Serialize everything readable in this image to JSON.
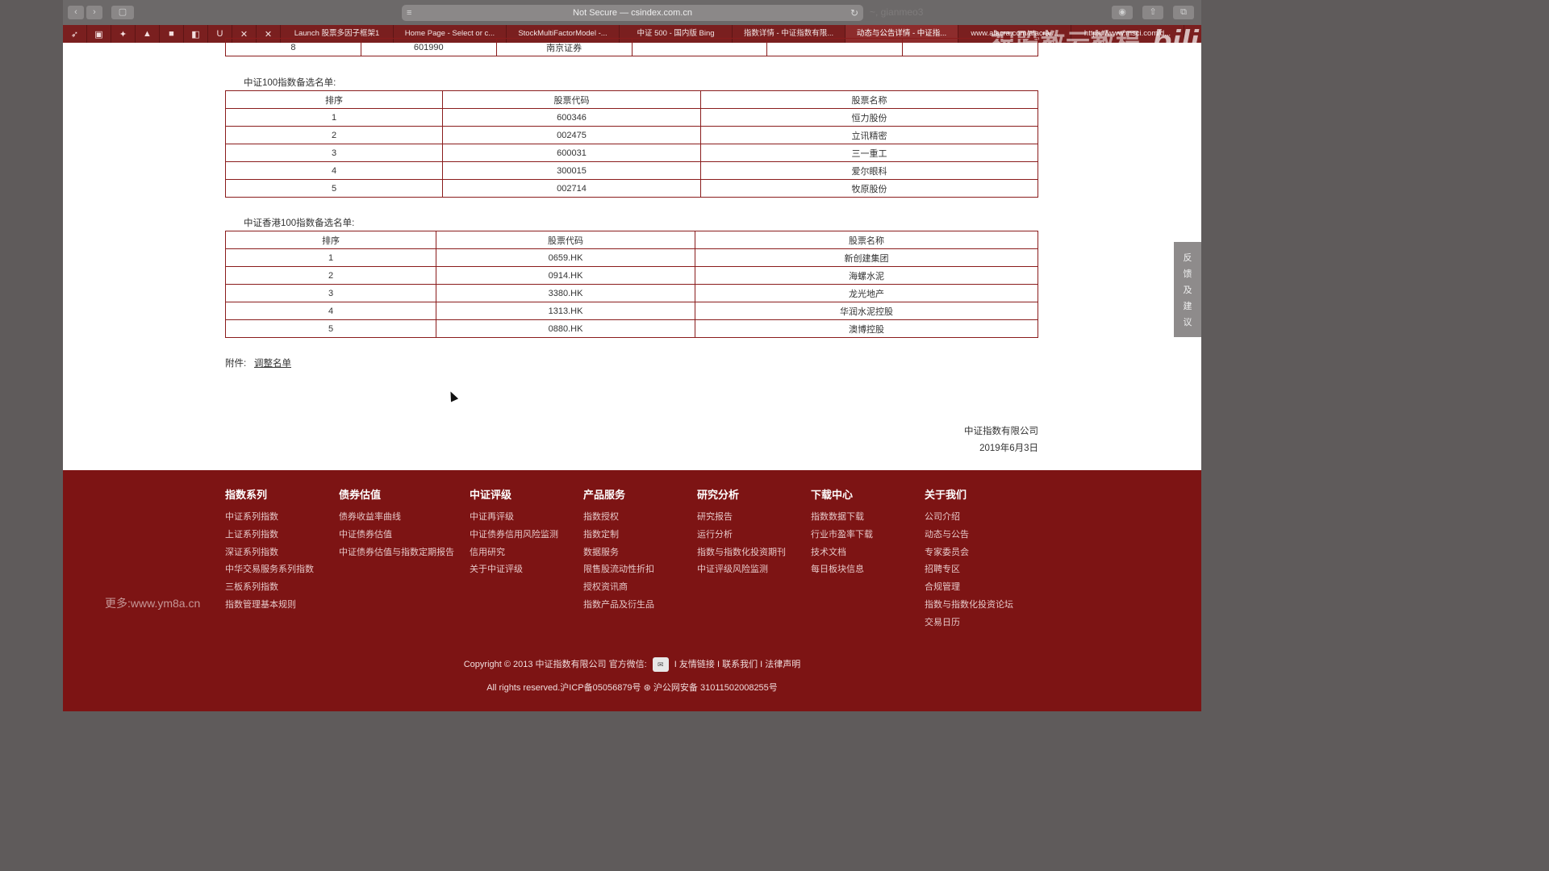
{
  "browser": {
    "back": "‹",
    "forward": "›",
    "sidebar_icon": "▢",
    "address": "Not Secure — csindex.com.cn",
    "user_ghost": "~, gianmeo3",
    "tabs": [
      "Launch 股票多因子框架1",
      "Home Page - Select or c...",
      "StockMultiFactorModel -...",
      "中证 500 - 国内版 Bing",
      "指数详情 - 中证指数有限...",
      "动态与公告详情 - 中证指...",
      "www.alacra.com/alacra/...",
      "https://www.msci.com/d..."
    ],
    "active_tab": 5,
    "favicons": [
      "bird-icon",
      "bilibili-icon",
      "vertex-icon",
      "a-icon",
      "box-icon",
      "bookmark-icon",
      "u-icon",
      "x-icon",
      "x2-icon"
    ]
  },
  "watermark": {
    "text": "祝股教云教程",
    "logo": "bilibili"
  },
  "top_row": {
    "rank": "8",
    "code": "601990",
    "name": "南京证券"
  },
  "csi100": {
    "caption": "中证100指数备选名单:",
    "headers": [
      "排序",
      "股票代码",
      "股票名称"
    ],
    "rows": [
      [
        "1",
        "600346",
        "恒力股份"
      ],
      [
        "2",
        "002475",
        "立讯精密"
      ],
      [
        "3",
        "600031",
        "三一重工"
      ],
      [
        "4",
        "300015",
        "爱尔眼科"
      ],
      [
        "5",
        "002714",
        "牧原股份"
      ]
    ]
  },
  "csihk100": {
    "caption": "中证香港100指数备选名单:",
    "headers": [
      "排序",
      "股票代码",
      "股票名称"
    ],
    "rows": [
      [
        "1",
        "0659.HK",
        "新创建集团"
      ],
      [
        "2",
        "0914.HK",
        "海螺水泥"
      ],
      [
        "3",
        "3380.HK",
        "龙光地产"
      ],
      [
        "4",
        "1313.HK",
        "华润水泥控股"
      ],
      [
        "5",
        "0880.HK",
        "澳博控股"
      ]
    ]
  },
  "attachment": {
    "label": "附件:",
    "link": "调整名单"
  },
  "signature": {
    "company": "中证指数有限公司",
    "date": "2019年6月3日"
  },
  "footer": {
    "columns": [
      {
        "title": "指数系列",
        "items": [
          "中证系列指数",
          "上证系列指数",
          "深证系列指数",
          "中华交易服务系列指数",
          "三板系列指数",
          "指数管理基本规则"
        ]
      },
      {
        "title": "债券估值",
        "items": [
          "债券收益率曲线",
          "中证债券估值",
          "中证债券估值与指数定期报告"
        ]
      },
      {
        "title": "中证评级",
        "items": [
          "中证再评级",
          "中证债券信用风险监测",
          "信用研究",
          "关于中证评级"
        ]
      },
      {
        "title": "产品服务",
        "items": [
          "指数授权",
          "指数定制",
          "数据服务",
          "限售股流动性折扣",
          "授权资讯商",
          "指数产品及衍生品"
        ]
      },
      {
        "title": "研究分析",
        "items": [
          "研究报告",
          "运行分析",
          "指数与指数化投资期刊",
          "中证评级风险监测"
        ]
      },
      {
        "title": "下载中心",
        "items": [
          "指数数据下载",
          "行业市盈率下载",
          "技术文档",
          "每日板块信息"
        ]
      },
      {
        "title": "关于我们",
        "items": [
          "公司介绍",
          "动态与公告",
          "专家委员会",
          "招聘专区",
          "合规管理",
          "指数与指数化投资论坛",
          "交易日历"
        ]
      }
    ],
    "more": "更多:www.ym8a.cn",
    "copyright_pre": "Copyright © 2013 中证指数有限公司 官方微信:",
    "copyright_links": "I 友情链接 I 联系我们 I 法律声明",
    "rights": "All rights reserved.沪ICP备05056879号",
    "police": "沪公网安备 31011502008255号"
  },
  "feedback": [
    "反",
    "馈",
    "及",
    "建",
    "议"
  ]
}
